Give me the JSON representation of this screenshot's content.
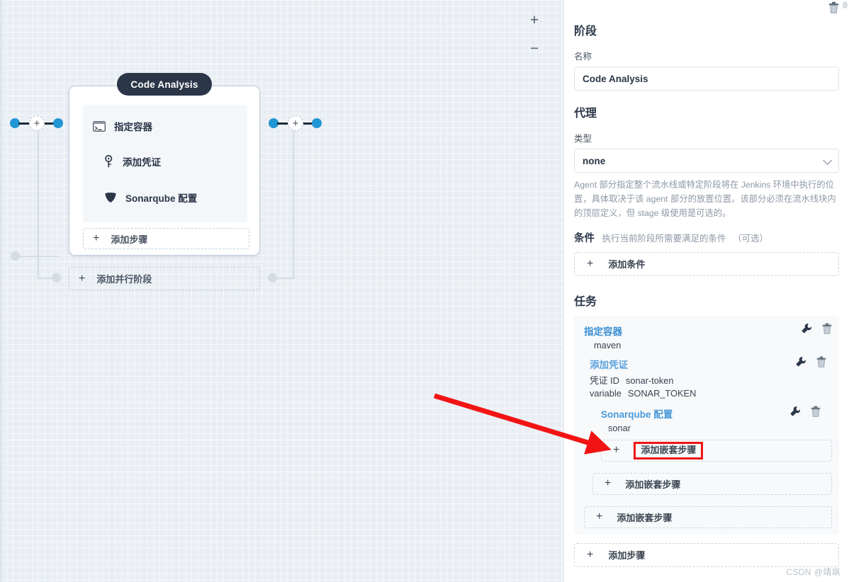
{
  "canvas": {
    "zoom_in_label": "+",
    "zoom_out_label": "−",
    "stage": {
      "title": "Code Analysis",
      "steps": [
        {
          "icon": "terminal-icon",
          "label": "指定容器"
        },
        {
          "icon": "key-icon",
          "label": "添加凭证"
        },
        {
          "icon": "shield-icon",
          "label": "Sonarqube 配置"
        }
      ],
      "add_step_label": "添加步骤",
      "add_step_plus": "+"
    },
    "add_parallel_label": "添加并行阶段",
    "add_parallel_plus": "+"
  },
  "panel": {
    "stage_section_title": "阶段",
    "delete_icon": "trash-icon",
    "name_label": "名称",
    "name_value": "Code Analysis",
    "agent_section_title": "代理",
    "type_label": "类型",
    "type_value": "none",
    "agent_help": "Agent 部分指定整个流水线或特定阶段将在 Jenkins 环境中执行的位置，具体取决于该 agent 部分的放置位置。该部分必须在流水线块内的顶层定义，但 stage 级使用是可选的。",
    "condition_title": "条件",
    "condition_desc": "执行当前阶段所需要满足的条件",
    "condition_optional": "（可选）",
    "add_condition_label": "添加条件",
    "add_condition_plus": "+",
    "tasks_section_title": "任务",
    "tasks": [
      {
        "name": "指定容器",
        "level": 0,
        "fields": [
          {
            "key": "maven",
            "value": ""
          }
        ],
        "edit_icon": "wrench-icon",
        "delete_icon": "trash-icon"
      },
      {
        "name": "添加凭证",
        "level": 1,
        "fields": [
          {
            "key": "凭证 ID",
            "value": "sonar-token"
          },
          {
            "key": "variable",
            "value": "SONAR_TOKEN"
          }
        ],
        "edit_icon": "wrench-icon",
        "delete_icon": "trash-icon"
      },
      {
        "name": "Sonarqube 配置",
        "level": 2,
        "fields": [
          {
            "key": "sonar",
            "value": ""
          }
        ],
        "edit_icon": "wrench-icon",
        "delete_icon": "trash-icon"
      }
    ],
    "nested_buttons": [
      {
        "label": "添加嵌套步骤",
        "plus": "+",
        "highlighted": true
      },
      {
        "label": "添加嵌套步骤",
        "plus": "+",
        "highlighted": false
      },
      {
        "label": "添加嵌套步骤",
        "plus": "+",
        "highlighted": false
      }
    ],
    "add_step_label": "添加步骤",
    "add_step_plus": "+"
  },
  "annotation": {
    "arrow_color": "#f21414",
    "highlight_color": "#f01414"
  },
  "watermark": "CSDN @靖飒",
  "colors": {
    "canvas_bg": "#e9eef3",
    "node_dot": "#2196d4",
    "stage_title_bg": "#2b3648",
    "link_blue": "#3a8fd4",
    "muted_text": "#8d98a6"
  }
}
